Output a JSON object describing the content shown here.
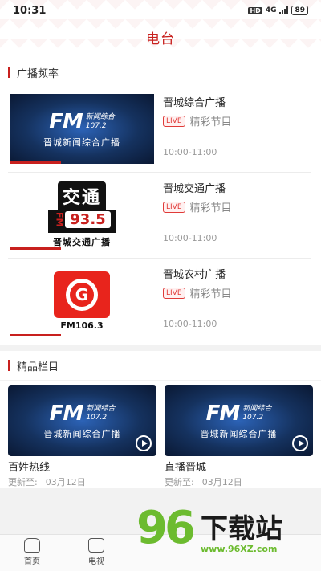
{
  "status_bar": {
    "time": "10:31",
    "hd": "HD",
    "network": "4G",
    "battery": "89"
  },
  "header": {
    "title": "电台"
  },
  "broadcast": {
    "section_title": "广播频率",
    "items": [
      {
        "name": "晋城综合广播",
        "live": "LIVE",
        "desc": "精彩节目",
        "time": "10:00-11:00",
        "logo": "fm-107-2"
      },
      {
        "name": "晋城交通广播",
        "live": "LIVE",
        "desc": "精彩节目",
        "time": "10:00-11:00",
        "logo": "jiaotong-93-5"
      },
      {
        "name": "晋城农村广播",
        "live": "LIVE",
        "desc": "精彩节目",
        "time": "10:00-11:00",
        "logo": "fm-106-3"
      }
    ]
  },
  "logos": {
    "fm1072": {
      "big": "FM",
      "line1": "新闻综合",
      "line2": "107.2",
      "sub": "晋城新闻综合广播"
    },
    "jt935": {
      "top": "交通",
      "fm": "FM",
      "num": "93.5",
      "bottom": "晋城交通广播"
    },
    "fm1063": {
      "letter": "G",
      "text": "FM106.3"
    }
  },
  "columns": {
    "section_title": "精品栏目",
    "items": [
      {
        "name": "百姓热线",
        "update_label": "更新至:",
        "update_date": "03月12日"
      },
      {
        "name": "直播晋城",
        "update_label": "更新至:",
        "update_date": "03月12日"
      }
    ]
  },
  "tabbar": {
    "items": [
      {
        "label": "首页",
        "icon": "home-icon"
      },
      {
        "label": "电视",
        "icon": "tv-icon"
      }
    ]
  },
  "watermark": {
    "number": "96",
    "text": "下载站",
    "url": "www.96XZ.com"
  },
  "colors": {
    "accent": "#c8201e",
    "live": "#e03a38",
    "watermark_green": "#6cbb2f"
  }
}
